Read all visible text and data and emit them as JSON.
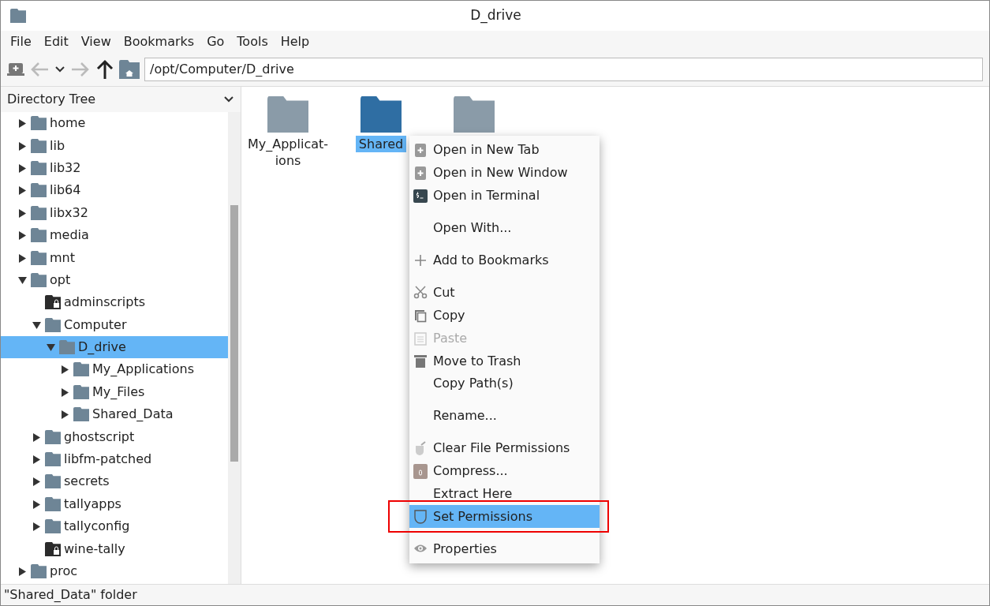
{
  "window": {
    "title": "D_drive"
  },
  "menubar": [
    "File",
    "Edit",
    "View",
    "Bookmarks",
    "Go",
    "Tools",
    "Help"
  ],
  "toolbar": {
    "back_disabled": true,
    "forward_disabled": true,
    "path": "/opt/Computer/D_drive"
  },
  "sidebar": {
    "title": "Directory Tree",
    "tree": [
      {
        "name": "home",
        "expanded": false,
        "selected": false
      },
      {
        "name": "lib",
        "expanded": false,
        "selected": false
      },
      {
        "name": "lib32",
        "expanded": false,
        "selected": false
      },
      {
        "name": "lib64",
        "expanded": false,
        "selected": false
      },
      {
        "name": "libx32",
        "expanded": false,
        "selected": false
      },
      {
        "name": "media",
        "expanded": false,
        "selected": false
      },
      {
        "name": "mnt",
        "expanded": false,
        "selected": false
      },
      {
        "name": "opt",
        "expanded": true,
        "selected": false,
        "children": [
          {
            "name": "adminscripts",
            "locked": true,
            "selected": false
          },
          {
            "name": "Computer",
            "expanded": true,
            "selected": false,
            "children": [
              {
                "name": "D_drive",
                "expanded": true,
                "selected": true,
                "children": [
                  {
                    "name": "My_Applications",
                    "expanded": false,
                    "selected": false
                  },
                  {
                    "name": "My_Files",
                    "expanded": false,
                    "selected": false
                  },
                  {
                    "name": "Shared_Data",
                    "expanded": false,
                    "selected": false
                  }
                ]
              }
            ]
          },
          {
            "name": "ghostscript",
            "expanded": false,
            "selected": false
          },
          {
            "name": "libfm-patched",
            "expanded": false,
            "selected": false
          },
          {
            "name": "secrets",
            "expanded": false,
            "selected": false
          },
          {
            "name": "tallyapps",
            "expanded": false,
            "selected": false
          },
          {
            "name": "tallyconfig",
            "expanded": false,
            "selected": false
          },
          {
            "name": "wine-tally",
            "locked": true,
            "selected": false
          }
        ]
      },
      {
        "name": "proc",
        "expanded": false,
        "selected": false
      }
    ]
  },
  "files": [
    {
      "name": "My_Applicat-\nions",
      "selected": false
    },
    {
      "name": "Shared",
      "selected": true
    },
    {
      "selected": false
    }
  ],
  "context_menu": [
    {
      "kind": "item",
      "label": "Open in New Tab",
      "disabled": false,
      "selected": false
    },
    {
      "kind": "item",
      "label": "Open in New Window",
      "disabled": false,
      "selected": false
    },
    {
      "kind": "item",
      "label": "Open in Terminal",
      "disabled": false,
      "selected": false
    },
    {
      "kind": "separator"
    },
    {
      "kind": "item",
      "label": "Open With...",
      "disabled": false,
      "selected": false
    },
    {
      "kind": "separator"
    },
    {
      "kind": "item",
      "label": "Add to Bookmarks",
      "disabled": false,
      "selected": false
    },
    {
      "kind": "separator"
    },
    {
      "kind": "item",
      "label": "Cut",
      "disabled": false,
      "selected": false
    },
    {
      "kind": "item",
      "label": "Copy",
      "disabled": false,
      "selected": false
    },
    {
      "kind": "item",
      "label": "Paste",
      "disabled": true,
      "selected": false
    },
    {
      "kind": "item",
      "label": "Move to Trash",
      "disabled": false,
      "selected": false
    },
    {
      "kind": "item",
      "label": "Copy Path(s)",
      "disabled": false,
      "selected": false
    },
    {
      "kind": "separator"
    },
    {
      "kind": "item",
      "label": "Rename...",
      "disabled": false,
      "selected": false
    },
    {
      "kind": "separator"
    },
    {
      "kind": "item",
      "label": "Clear File Permissions",
      "disabled": false,
      "selected": false
    },
    {
      "kind": "item",
      "label": "Compress...",
      "disabled": false,
      "selected": false
    },
    {
      "kind": "item",
      "label": "Extract Here",
      "disabled": false,
      "selected": false
    },
    {
      "kind": "item",
      "label": "Set Permissions",
      "disabled": false,
      "selected": true,
      "highlighted": true
    },
    {
      "kind": "separator"
    },
    {
      "kind": "item",
      "label": "Properties",
      "disabled": false,
      "selected": false
    }
  ],
  "status_bar": "\"Shared_Data\" folder"
}
